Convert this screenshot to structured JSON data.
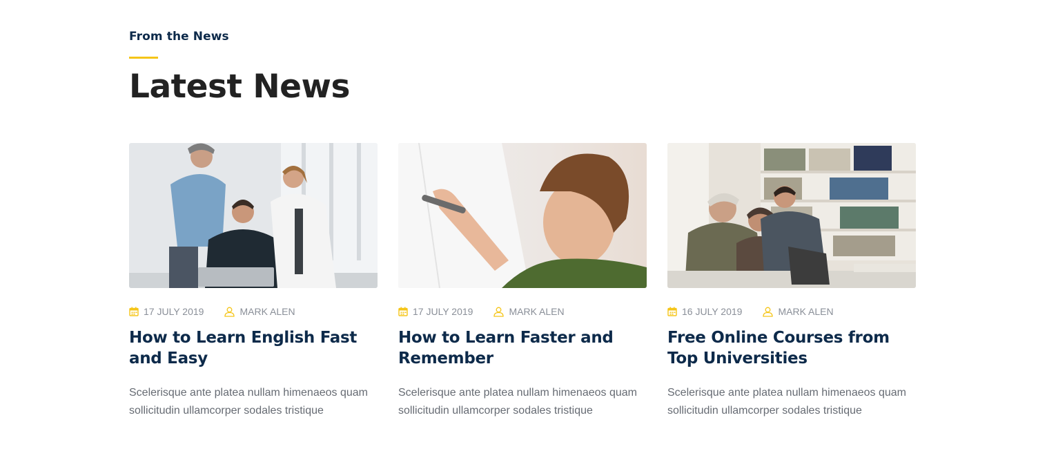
{
  "section": {
    "eyebrow": "From the News",
    "heading": "Latest News"
  },
  "posts": [
    {
      "image": "team-meeting-photo",
      "date": "17 JULY 2019",
      "author": "MARK ALEN",
      "title": "How to Learn English Fast and Easy",
      "excerpt": "Scelerisque ante platea nullam himenaeos quam sollicitudin ullamcorper sodales tristique"
    },
    {
      "image": "boy-writing-photo",
      "date": "17 JULY 2019",
      "author": "MARK ALEN",
      "title": "How to Learn Faster and Remember",
      "excerpt": "Scelerisque ante platea nullam himenaeos quam sollicitudin ullamcorper sodales tristique"
    },
    {
      "image": "students-library-photo",
      "date": "16 JULY 2019",
      "author": "MARK ALEN",
      "title": "Free Online Courses from Top Universities",
      "excerpt": "Scelerisque ante platea nullam himenaeos quam sollicitudin ullamcorper sodales tristique"
    }
  ],
  "icons": {
    "date": "calendar-icon",
    "author": "user-icon"
  },
  "colors": {
    "accent": "#f5c518",
    "title": "#0d2a4a",
    "heading": "#222222",
    "meta": "#8a8f98",
    "text": "#666b73"
  }
}
